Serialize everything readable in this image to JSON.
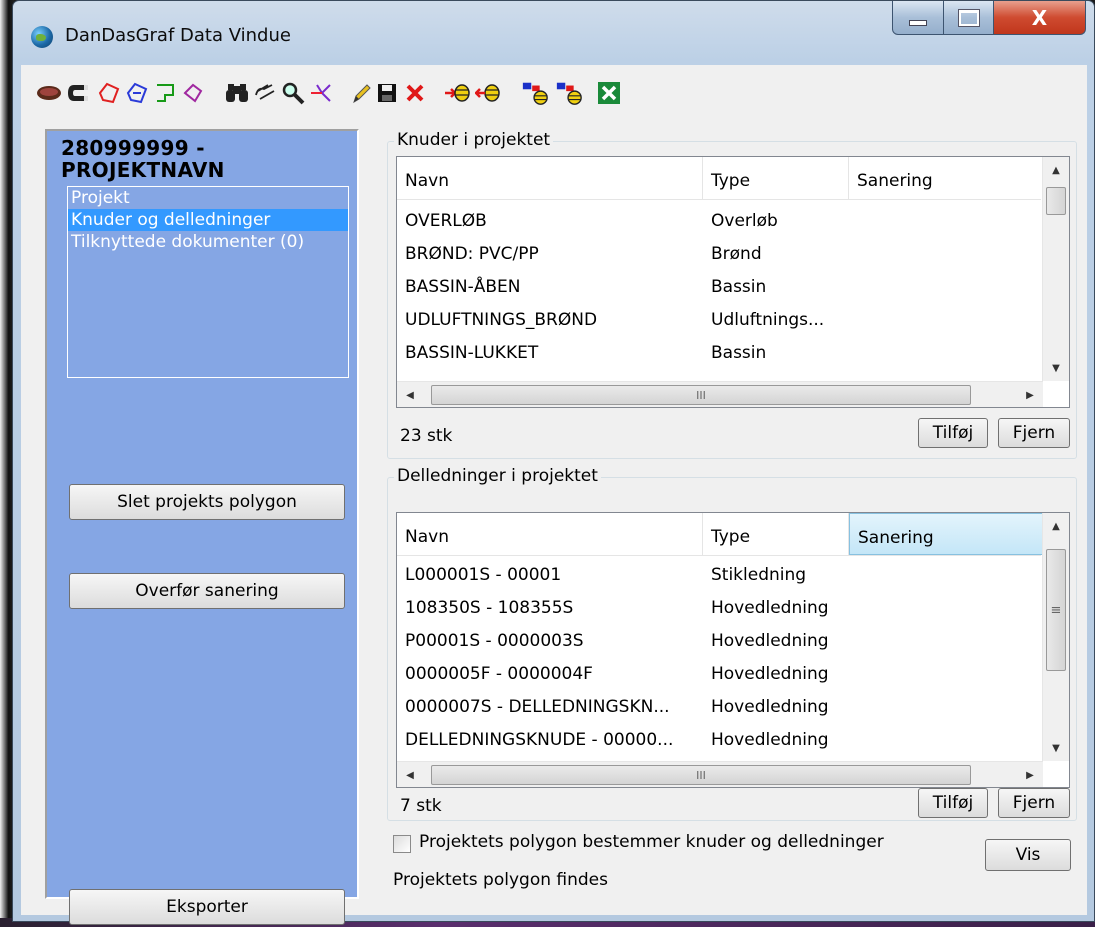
{
  "window": {
    "title": "DanDasGraf  Data Vindue"
  },
  "caption_buttons": {
    "close": "X"
  },
  "toolbar": {
    "icons": [
      "polygon-icon",
      "magnet-icon",
      "draw-polygon-icon",
      "edit-polygon-icon",
      "rectangle-select-icon",
      "freehand-select-icon",
      "binoculars-icon",
      "hand-select-icon",
      "zoom-icon",
      "route-icon",
      "pencil-icon",
      "save-icon",
      "delete-icon",
      "add-node-icon",
      "remove-node-icon",
      "add-pipe-icon",
      "remove-pipe-icon",
      "close-icon"
    ]
  },
  "left_panel": {
    "project_title": "280999999 - PROJEKTNAVN",
    "nav": [
      {
        "label": "Projekt",
        "selected": false
      },
      {
        "label": "Knuder og delledninger",
        "selected": true
      },
      {
        "label": "Tilknyttede dokumenter (0)",
        "selected": false
      }
    ],
    "delete_polygon_button": "Slet projekts polygon",
    "transfer_button": "Overfør sanering",
    "export_button": "Eksporter"
  },
  "nodes": {
    "group_title": "Knuder i projektet",
    "columns": [
      "Navn",
      "Type",
      "Sanering"
    ],
    "rows": [
      [
        "OVERLØB",
        "Overløb",
        ""
      ],
      [
        "BRØND: PVC/PP",
        "Brønd",
        ""
      ],
      [
        "BASSIN-ÅBEN",
        "Bassin",
        ""
      ],
      [
        "UDLUFTNINGS_BRØND",
        "Udluftnings...",
        ""
      ],
      [
        "BASSIN-LUKKET",
        "Bassin",
        ""
      ]
    ],
    "count": "23 stk",
    "add_button": "Tilføj",
    "remove_button": "Fjern",
    "hscroll_grip": "III"
  },
  "pipes": {
    "group_title": "Delledninger i projektet",
    "columns": [
      "Navn",
      "Type",
      "Sanering"
    ],
    "rows": [
      [
        "L000001S - 00001",
        "Stikledning",
        ""
      ],
      [
        "108350S - 108355S",
        "Hovedledning",
        ""
      ],
      [
        "P00001S - 0000003S",
        "Hovedledning",
        ""
      ],
      [
        "0000005F - 0000004F",
        "Hovedledning",
        ""
      ],
      [
        "0000007S - DELLEDNINGSKN...",
        "Hovedledning",
        ""
      ],
      [
        "DELLEDNINGSKNUDE - 00000...",
        "Hovedledning",
        ""
      ]
    ],
    "count": "7 stk",
    "add_button": "Tilføj",
    "remove_button": "Fjern",
    "hscroll_grip": "III",
    "vscroll_grip": "≡"
  },
  "footer": {
    "checkbox_label": "Projektets polygon bestemmer knuder og delledninger",
    "checkbox_checked": false,
    "show_button": "Vis",
    "status": "Projektets polygon findes"
  }
}
